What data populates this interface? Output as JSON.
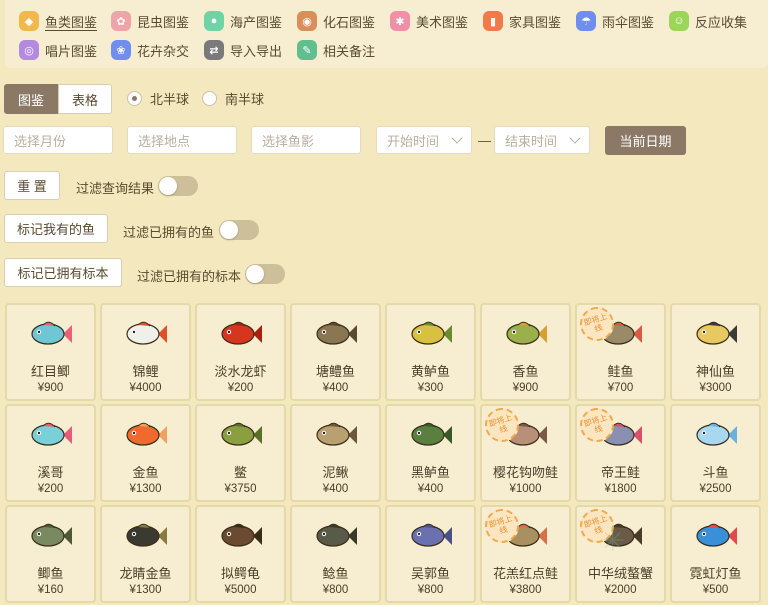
{
  "nav": {
    "items": [
      {
        "label": "鱼类图鉴",
        "icon": "fish-icon",
        "color": "#f2b84b",
        "active": true
      },
      {
        "label": "昆虫图鉴",
        "icon": "bug-icon",
        "color": "#f0a3a8"
      },
      {
        "label": "海产图鉴",
        "icon": "shell-icon",
        "color": "#6fd3a5"
      },
      {
        "label": "化石图鉴",
        "icon": "fossil-icon",
        "color": "#d98f5a"
      },
      {
        "label": "美术图鉴",
        "icon": "art-icon",
        "color": "#f08fa8"
      },
      {
        "label": "家具图鉴",
        "icon": "furniture-icon",
        "color": "#f07a4a"
      },
      {
        "label": "雨伞图鉴",
        "icon": "umbrella-icon",
        "color": "#6f8ef0"
      },
      {
        "label": "反应收集",
        "icon": "smile-icon",
        "color": "#9bd65a"
      },
      {
        "label": "唱片图鉴",
        "icon": "record-icon",
        "color": "#b48ae0"
      },
      {
        "label": "花卉杂交",
        "icon": "flower-icon",
        "color": "#6f8ef0"
      },
      {
        "label": "导入导出",
        "icon": "swap-icon",
        "color": "#7a7a7a"
      },
      {
        "label": "相关备注",
        "icon": "note-icon",
        "color": "#5fbf8f"
      }
    ]
  },
  "view_tabs": {
    "gallery": "图鉴",
    "table": "表格"
  },
  "hemisphere": {
    "north": "北半球",
    "south": "南半球",
    "selected": "north"
  },
  "filters": {
    "month_placeholder": "选择月份",
    "location_placeholder": "选择地点",
    "shadow_placeholder": "选择鱼影",
    "start_time_placeholder": "开始时间",
    "end_time_placeholder": "结束时间",
    "separator": "—",
    "current_date_button": "当前日期",
    "reset_button": "重 置",
    "filter_results_label": "过滤查询结果",
    "mark_owned_fish_button": "标记我有的鱼",
    "filter_owned_fish_label": "过滤已拥有的鱼",
    "mark_owned_specimen_button": "标记已拥有标本",
    "filter_owned_specimen_label": "过滤已拥有的标本"
  },
  "badge_text": "即将上线",
  "fish": [
    {
      "name": "红目鲫",
      "price": "¥900",
      "body": "#6fc7d6",
      "fin": "#e8607a"
    },
    {
      "name": "锦鲤",
      "price": "¥4000",
      "body": "#f0f0ea",
      "fin": "#e0502a"
    },
    {
      "name": "淡水龙虾",
      "price": "¥200",
      "body": "#d8351f",
      "fin": "#a82010"
    },
    {
      "name": "塘鳢鱼",
      "price": "¥400",
      "body": "#8a7650",
      "fin": "#5a4a2e"
    },
    {
      "name": "黄鲈鱼",
      "price": "¥300",
      "body": "#d8c040",
      "fin": "#6a8a30"
    },
    {
      "name": "香鱼",
      "price": "¥900",
      "body": "#9ab04a",
      "fin": "#d8a030"
    },
    {
      "name": "鲑鱼",
      "price": "¥700",
      "body": "#9a8a68",
      "fin": "#d85a40",
      "badge": true
    },
    {
      "name": "神仙鱼",
      "price": "¥3000",
      "body": "#e8c860",
      "fin": "#3a3a3a"
    },
    {
      "name": "溪哥",
      "price": "¥200",
      "body": "#7ad0d8",
      "fin": "#e85a7a"
    },
    {
      "name": "金鱼",
      "price": "¥1300",
      "body": "#f06a30",
      "fin": "#f0a060"
    },
    {
      "name": "鳖",
      "price": "¥3750",
      "body": "#8aa040",
      "fin": "#5a7028"
    },
    {
      "name": "泥鳅",
      "price": "¥400",
      "body": "#b8a070",
      "fin": "#6a5838"
    },
    {
      "name": "黑鲈鱼",
      "price": "¥400",
      "body": "#5a8040",
      "fin": "#3a5828"
    },
    {
      "name": "樱花钩吻鲑",
      "price": "¥1000",
      "body": "#b89078",
      "fin": "#7a5a48",
      "badge": true
    },
    {
      "name": "帝王鲑",
      "price": "¥1800",
      "body": "#8a90b0",
      "fin": "#d8506a",
      "badge": true
    },
    {
      "name": "斗鱼",
      "price": "¥2500",
      "body": "#a8d8f0",
      "fin": "#6ab0e0"
    },
    {
      "name": "鲫鱼",
      "price": "¥160",
      "body": "#7a8a60",
      "fin": "#4a5a38"
    },
    {
      "name": "龙睛金鱼",
      "price": "¥1300",
      "body": "#3a3a30",
      "fin": "#8a7a40"
    },
    {
      "name": "拟鳄龟",
      "price": "¥5000",
      "body": "#6a4a30",
      "fin": "#3a2a18"
    },
    {
      "name": "鲶鱼",
      "price": "¥800",
      "body": "#5a5a48",
      "fin": "#3a3a2a"
    },
    {
      "name": "吴郭鱼",
      "price": "¥800",
      "body": "#6a70b0",
      "fin": "#4a5088"
    },
    {
      "name": "花羔红点鲑",
      "price": "¥3800",
      "body": "#a89060",
      "fin": "#d8704a",
      "badge": true
    },
    {
      "name": "中华绒螯蟹",
      "price": "¥2000",
      "body": "#6a5a48",
      "fin": "#4a3a28",
      "badge": true
    },
    {
      "name": "霓虹灯鱼",
      "price": "¥500",
      "body": "#3a90d8",
      "fin": "#e04a4a"
    }
  ]
}
